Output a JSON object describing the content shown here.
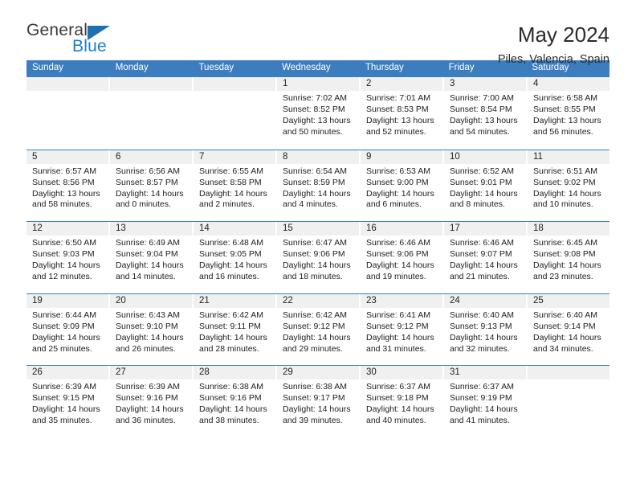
{
  "brand": {
    "name_top": "General",
    "name_bottom": "Blue",
    "accent_color": "#1f7ec4",
    "triangle_color": "#1f6fb2"
  },
  "header": {
    "title": "May 2024",
    "subtitle": "Piles, Valencia, Spain"
  },
  "calendar": {
    "header_bg": "#3b7dbf",
    "daynum_bg": "#f0f0f0",
    "weekdays": [
      "Sunday",
      "Monday",
      "Tuesday",
      "Wednesday",
      "Thursday",
      "Friday",
      "Saturday"
    ],
    "weeks": [
      [
        {
          "day": "",
          "lines": []
        },
        {
          "day": "",
          "lines": []
        },
        {
          "day": "",
          "lines": []
        },
        {
          "day": "1",
          "lines": [
            "Sunrise: 7:02 AM",
            "Sunset: 8:52 PM",
            "Daylight: 13 hours",
            "and 50 minutes."
          ]
        },
        {
          "day": "2",
          "lines": [
            "Sunrise: 7:01 AM",
            "Sunset: 8:53 PM",
            "Daylight: 13 hours",
            "and 52 minutes."
          ]
        },
        {
          "day": "3",
          "lines": [
            "Sunrise: 7:00 AM",
            "Sunset: 8:54 PM",
            "Daylight: 13 hours",
            "and 54 minutes."
          ]
        },
        {
          "day": "4",
          "lines": [
            "Sunrise: 6:58 AM",
            "Sunset: 8:55 PM",
            "Daylight: 13 hours",
            "and 56 minutes."
          ]
        }
      ],
      [
        {
          "day": "5",
          "lines": [
            "Sunrise: 6:57 AM",
            "Sunset: 8:56 PM",
            "Daylight: 13 hours",
            "and 58 minutes."
          ]
        },
        {
          "day": "6",
          "lines": [
            "Sunrise: 6:56 AM",
            "Sunset: 8:57 PM",
            "Daylight: 14 hours",
            "and 0 minutes."
          ]
        },
        {
          "day": "7",
          "lines": [
            "Sunrise: 6:55 AM",
            "Sunset: 8:58 PM",
            "Daylight: 14 hours",
            "and 2 minutes."
          ]
        },
        {
          "day": "8",
          "lines": [
            "Sunrise: 6:54 AM",
            "Sunset: 8:59 PM",
            "Daylight: 14 hours",
            "and 4 minutes."
          ]
        },
        {
          "day": "9",
          "lines": [
            "Sunrise: 6:53 AM",
            "Sunset: 9:00 PM",
            "Daylight: 14 hours",
            "and 6 minutes."
          ]
        },
        {
          "day": "10",
          "lines": [
            "Sunrise: 6:52 AM",
            "Sunset: 9:01 PM",
            "Daylight: 14 hours",
            "and 8 minutes."
          ]
        },
        {
          "day": "11",
          "lines": [
            "Sunrise: 6:51 AM",
            "Sunset: 9:02 PM",
            "Daylight: 14 hours",
            "and 10 minutes."
          ]
        }
      ],
      [
        {
          "day": "12",
          "lines": [
            "Sunrise: 6:50 AM",
            "Sunset: 9:03 PM",
            "Daylight: 14 hours",
            "and 12 minutes."
          ]
        },
        {
          "day": "13",
          "lines": [
            "Sunrise: 6:49 AM",
            "Sunset: 9:04 PM",
            "Daylight: 14 hours",
            "and 14 minutes."
          ]
        },
        {
          "day": "14",
          "lines": [
            "Sunrise: 6:48 AM",
            "Sunset: 9:05 PM",
            "Daylight: 14 hours",
            "and 16 minutes."
          ]
        },
        {
          "day": "15",
          "lines": [
            "Sunrise: 6:47 AM",
            "Sunset: 9:06 PM",
            "Daylight: 14 hours",
            "and 18 minutes."
          ]
        },
        {
          "day": "16",
          "lines": [
            "Sunrise: 6:46 AM",
            "Sunset: 9:06 PM",
            "Daylight: 14 hours",
            "and 19 minutes."
          ]
        },
        {
          "day": "17",
          "lines": [
            "Sunrise: 6:46 AM",
            "Sunset: 9:07 PM",
            "Daylight: 14 hours",
            "and 21 minutes."
          ]
        },
        {
          "day": "18",
          "lines": [
            "Sunrise: 6:45 AM",
            "Sunset: 9:08 PM",
            "Daylight: 14 hours",
            "and 23 minutes."
          ]
        }
      ],
      [
        {
          "day": "19",
          "lines": [
            "Sunrise: 6:44 AM",
            "Sunset: 9:09 PM",
            "Daylight: 14 hours",
            "and 25 minutes."
          ]
        },
        {
          "day": "20",
          "lines": [
            "Sunrise: 6:43 AM",
            "Sunset: 9:10 PM",
            "Daylight: 14 hours",
            "and 26 minutes."
          ]
        },
        {
          "day": "21",
          "lines": [
            "Sunrise: 6:42 AM",
            "Sunset: 9:11 PM",
            "Daylight: 14 hours",
            "and 28 minutes."
          ]
        },
        {
          "day": "22",
          "lines": [
            "Sunrise: 6:42 AM",
            "Sunset: 9:12 PM",
            "Daylight: 14 hours",
            "and 29 minutes."
          ]
        },
        {
          "day": "23",
          "lines": [
            "Sunrise: 6:41 AM",
            "Sunset: 9:12 PM",
            "Daylight: 14 hours",
            "and 31 minutes."
          ]
        },
        {
          "day": "24",
          "lines": [
            "Sunrise: 6:40 AM",
            "Sunset: 9:13 PM",
            "Daylight: 14 hours",
            "and 32 minutes."
          ]
        },
        {
          "day": "25",
          "lines": [
            "Sunrise: 6:40 AM",
            "Sunset: 9:14 PM",
            "Daylight: 14 hours",
            "and 34 minutes."
          ]
        }
      ],
      [
        {
          "day": "26",
          "lines": [
            "Sunrise: 6:39 AM",
            "Sunset: 9:15 PM",
            "Daylight: 14 hours",
            "and 35 minutes."
          ]
        },
        {
          "day": "27",
          "lines": [
            "Sunrise: 6:39 AM",
            "Sunset: 9:16 PM",
            "Daylight: 14 hours",
            "and 36 minutes."
          ]
        },
        {
          "day": "28",
          "lines": [
            "Sunrise: 6:38 AM",
            "Sunset: 9:16 PM",
            "Daylight: 14 hours",
            "and 38 minutes."
          ]
        },
        {
          "day": "29",
          "lines": [
            "Sunrise: 6:38 AM",
            "Sunset: 9:17 PM",
            "Daylight: 14 hours",
            "and 39 minutes."
          ]
        },
        {
          "day": "30",
          "lines": [
            "Sunrise: 6:37 AM",
            "Sunset: 9:18 PM",
            "Daylight: 14 hours",
            "and 40 minutes."
          ]
        },
        {
          "day": "31",
          "lines": [
            "Sunrise: 6:37 AM",
            "Sunset: 9:19 PM",
            "Daylight: 14 hours",
            "and 41 minutes."
          ]
        },
        {
          "day": "",
          "lines": []
        }
      ]
    ]
  }
}
